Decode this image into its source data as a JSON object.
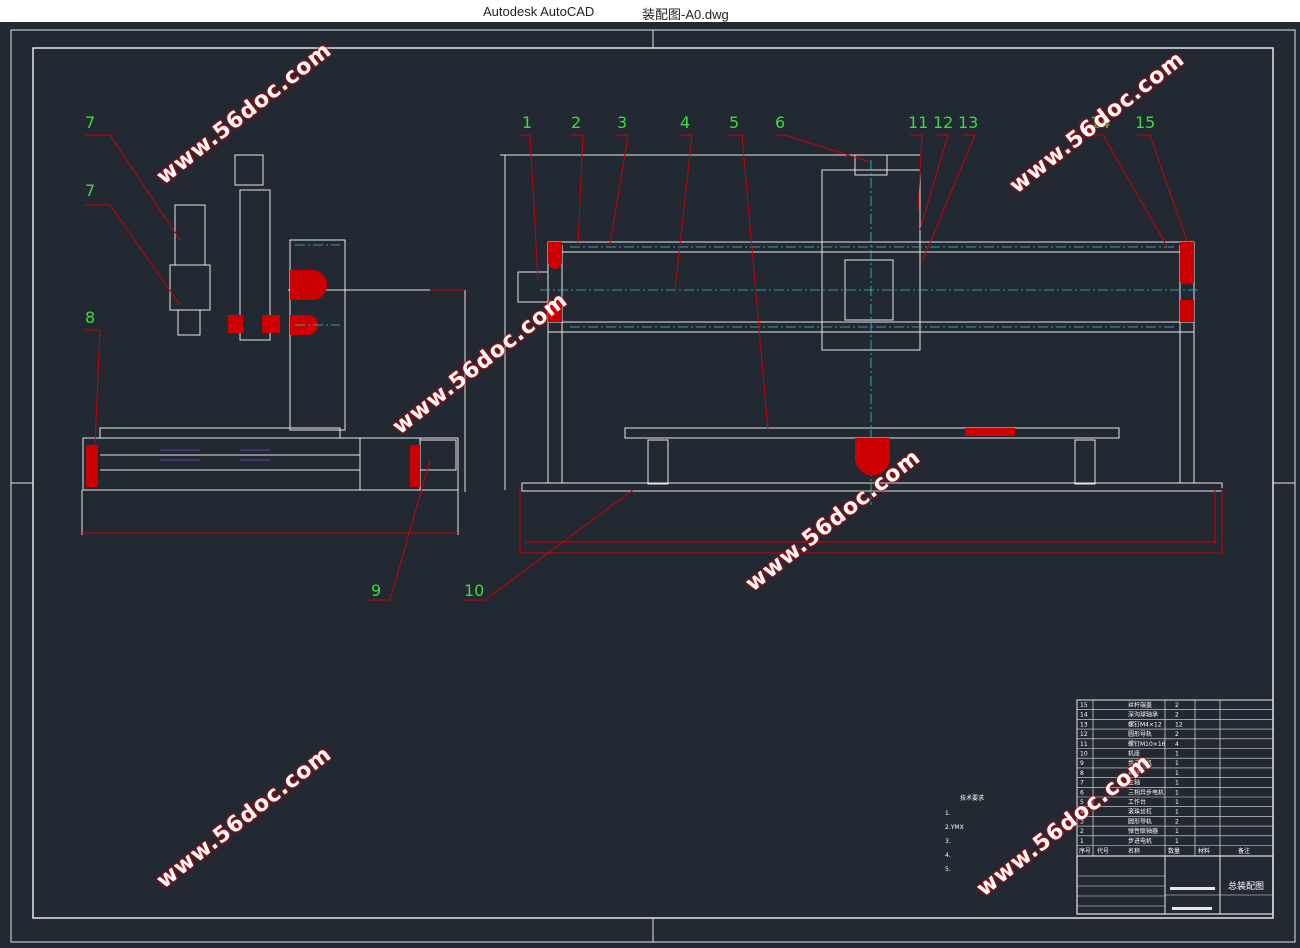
{
  "window": {
    "app_name": "Autodesk AutoCAD",
    "file_name": "装配图-A0.dwg"
  },
  "watermark": "www.56doc.com",
  "part_labels": [
    "1",
    "2",
    "3",
    "4",
    "5",
    "6",
    "7",
    "7",
    "8",
    "9",
    "10",
    "11",
    "12",
    "13",
    "14",
    "15"
  ],
  "parts_list": [
    {
      "no": "15",
      "name": "丝杆端盖",
      "qty": "2"
    },
    {
      "no": "14",
      "name": "深沟球轴承",
      "qty": "2"
    },
    {
      "no": "13",
      "name": "螺钉M4×12",
      "qty": "12"
    },
    {
      "no": "12",
      "name": "圆形导轨",
      "qty": "2"
    },
    {
      "no": "11",
      "name": "螺钉M10×16",
      "qty": "4"
    },
    {
      "no": "10",
      "name": "机座",
      "qty": "1"
    },
    {
      "no": "9",
      "name": "步进电机",
      "qty": "1"
    },
    {
      "no": "8",
      "name": "丝杆",
      "qty": "1"
    },
    {
      "no": "7",
      "name": "主轴",
      "qty": "1"
    },
    {
      "no": "6",
      "name": "三相异步电机",
      "qty": "1"
    },
    {
      "no": "5",
      "name": "工作台",
      "qty": "1"
    },
    {
      "no": "4",
      "name": "滚珠丝杠",
      "qty": "1"
    },
    {
      "no": "3",
      "name": "圆形导轨",
      "qty": "2"
    },
    {
      "no": "2",
      "name": "弹性联轴器",
      "qty": "1"
    },
    {
      "no": "1",
      "name": "步进电机",
      "qty": "1"
    }
  ],
  "parts_header": {
    "no": "序号",
    "code": "代号",
    "name": "名称",
    "qty": "数量",
    "material": "材料",
    "remark": "备注"
  },
  "drawing_title": "总装配图",
  "notes": {
    "title": "技术要求",
    "items": [
      "1.",
      "2.YMX",
      "3.",
      "4.",
      "5."
    ]
  }
}
